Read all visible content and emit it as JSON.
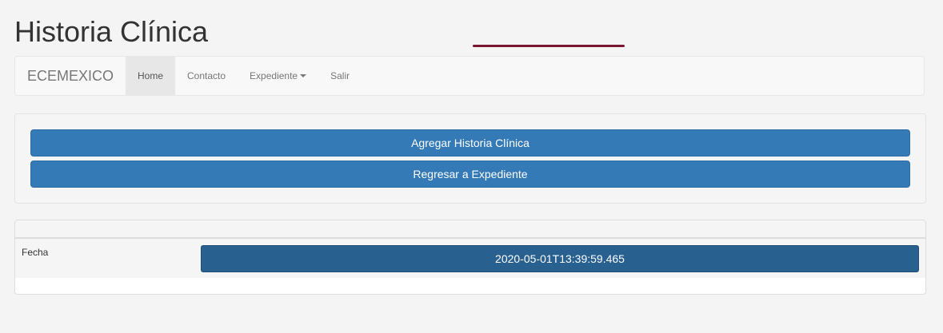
{
  "page": {
    "title": "Historia Clínica"
  },
  "navbar": {
    "brand": "ECEMEXICO",
    "items": [
      {
        "label": "Home",
        "active": true
      },
      {
        "label": "Contacto"
      },
      {
        "label": "Expediente",
        "dropdown": true
      },
      {
        "label": "Salir"
      }
    ]
  },
  "actions": {
    "add_label": "Agregar Historia Clínica",
    "back_label": "Regresar a Expediente"
  },
  "table": {
    "rows": [
      {
        "label": "Fecha",
        "value": "2020-05-01T13:39:59.465"
      }
    ]
  },
  "colors": {
    "primary": "#337ab7",
    "primary_dark": "#286090",
    "underline": "#7a1530"
  }
}
